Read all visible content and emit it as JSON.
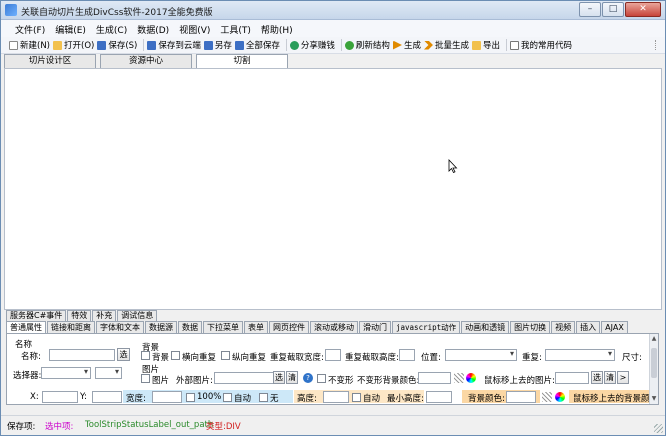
{
  "window": {
    "title": "关联自动切片生成DivCss软件-2017全能免费版",
    "min": "–",
    "max": "□",
    "close": "✕"
  },
  "menu": [
    "文件(F)",
    "编辑(E)",
    "生成(C)",
    "数据(D)",
    "视图(V)",
    "工具(T)",
    "帮助(H)"
  ],
  "toolbar": [
    {
      "label": "新建(N)",
      "icon": "new-file-icon",
      "color": "#f5f5f5"
    },
    {
      "label": "打开(O)",
      "icon": "open-folder-icon",
      "color": "#f2c14e"
    },
    {
      "label": "保存(S)",
      "icon": "save-icon",
      "color": "#3d6fc4"
    },
    {
      "label": "保存到云端",
      "icon": "cloud-save-icon",
      "color": "#3d6fc4"
    },
    {
      "label": "另存",
      "icon": "save-as-icon",
      "color": "#3d6fc4"
    },
    {
      "label": "全部保存",
      "icon": "save-all-icon",
      "color": "#3d6fc4"
    },
    {
      "label": "分享赚钱",
      "icon": "share-icon",
      "color": "#2a9d5b"
    },
    {
      "label": "刷新结构",
      "icon": "refresh-icon",
      "color": "#3aa33a"
    },
    {
      "label": "生成",
      "icon": "generate-icon",
      "color": "#e08a00"
    },
    {
      "label": "批量生成",
      "icon": "batch-generate-icon",
      "color": "#e08a00"
    },
    {
      "label": "导出",
      "icon": "export-icon",
      "color": "#f2c14e"
    },
    {
      "label": "我的常用代码",
      "icon": "code-page-icon",
      "color": "#ffffff"
    }
  ],
  "top_tabs": [
    "切片设计区",
    "资源中心",
    "切割"
  ],
  "bottom_tabs_row1": [
    "服务器C#事件",
    "特效",
    "补充",
    "调试信息"
  ],
  "bottom_tabs_row2": [
    "普通属性",
    "链接和距离",
    "字体和文本",
    "数据源",
    "数据",
    "下拉菜单",
    "表单",
    "网页控件",
    "滚动或移动",
    "滑动门",
    "javascript动作",
    "动画和透镜",
    "图片切换",
    "视频",
    "插入",
    "AJAX"
  ],
  "props": {
    "name_section": "名称",
    "name_label": "名称:",
    "select_btn": "选",
    "selector_label": "选择器:",
    "bg_section": "背景",
    "bg_check": "背景",
    "repeat_x": "横向重复",
    "repeat_y": "纵向重复",
    "repeat_width": "重复截取宽度:",
    "repeat_height": "重复截取高度:",
    "position": "位置:",
    "repeat": "重复:",
    "size": "尺寸:",
    "img_section": "图片",
    "img_check": "图片",
    "outer_img": "外部图片:",
    "clear_btn": "清",
    "help": "?",
    "no_deform": "不变形",
    "no_deform_bg": "不变形背景颜色:",
    "hover_img": "鼠标移上去的图片:",
    "arrow_btn": ">"
  },
  "strip": {
    "x": "X:",
    "y": "Y:",
    "width": "宽度:",
    "pct100": "100%",
    "auto": "自动",
    "none": "无",
    "height": "高度:",
    "auto2": "自动",
    "min_height": "最小高度:",
    "bg_color": "背景颜色:",
    "hover_bg": "鼠标移上去的背景颜"
  },
  "status": {
    "prefix": "保存项:",
    "selected": "选中项:",
    "item": "ToolStripStatusLabel_out_path",
    "type": "类型:DIV"
  },
  "colors": {
    "selected": "#cc00cc",
    "item": "#2a8a2a",
    "type": "#d21f1f"
  }
}
